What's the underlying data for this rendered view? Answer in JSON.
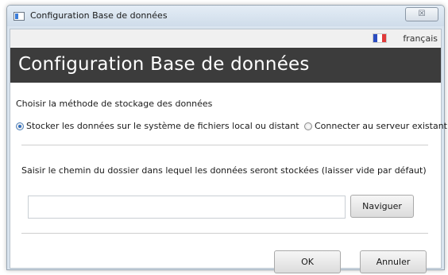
{
  "window": {
    "title": "Configuration Base de données",
    "close_glyph": "☒",
    "icons": {
      "app": "app-window-icon",
      "close": "close-icon"
    }
  },
  "language": {
    "label": "français",
    "flag_colors": [
      "#2b4cc0",
      "#ffffff",
      "#e03a3a"
    ],
    "flag_icon": "french-flag-icon"
  },
  "header": {
    "title": "Configuration Base de données",
    "background": "#3c3c3c"
  },
  "storage": {
    "prompt": "Choisir la méthode de stockage des données",
    "options": [
      {
        "label": "Stocker les données sur le système de fichiers local ou distant",
        "selected": true
      },
      {
        "label": "Connecter au serveur existant",
        "selected": false
      }
    ]
  },
  "folder": {
    "prompt": "Saisir le chemin du dossier dans lequel les données seront stockées (laisser vide par défaut)",
    "value": "",
    "browse_label": "Naviguer"
  },
  "footer": {
    "ok_label": "OK",
    "cancel_label": "Annuler"
  }
}
